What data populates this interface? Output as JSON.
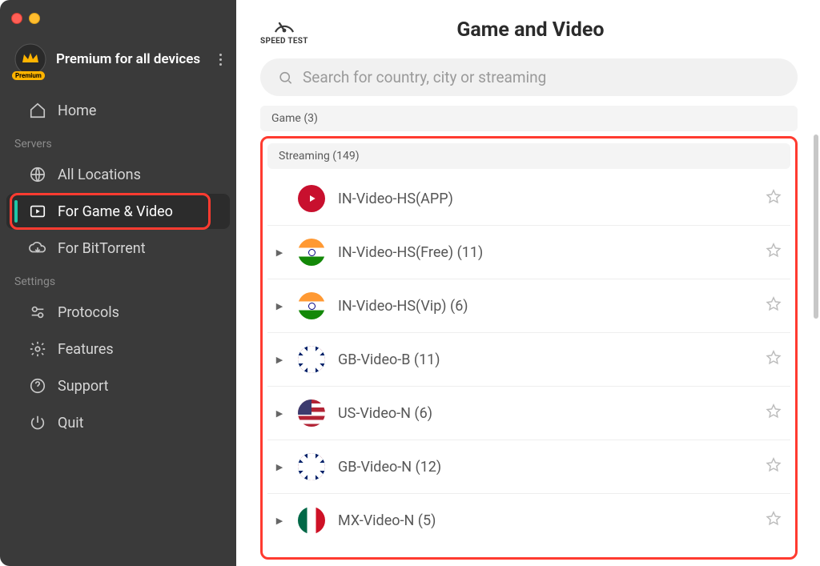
{
  "sidebar": {
    "premium_title": "Premium for all devices",
    "premium_pill": "Premium",
    "nav": {
      "home": "Home",
      "all_locations": "All Locations",
      "game_video": "For Game & Video",
      "bittorrent": "For BitTorrent",
      "protocols": "Protocols",
      "features": "Features",
      "support": "Support",
      "quit": "Quit"
    },
    "sections": {
      "servers": "Servers",
      "settings": "Settings"
    }
  },
  "main": {
    "speed_test": "SPEED TEST",
    "title": "Game and Video",
    "search_placeholder": "Search for country, city or streaming",
    "groups": {
      "game": "Game (3)",
      "streaming": "Streaming (149)"
    },
    "servers": [
      {
        "name": "IN-Video-HS(APP)",
        "flag": "hotstar",
        "expandable": false
      },
      {
        "name": "IN-Video-HS(Free) (11)",
        "flag": "in",
        "expandable": true
      },
      {
        "name": "IN-Video-HS(Vip) (6)",
        "flag": "in",
        "expandable": true
      },
      {
        "name": "GB-Video-B (11)",
        "flag": "gb",
        "expandable": true
      },
      {
        "name": "US-Video-N (6)",
        "flag": "us",
        "expandable": true
      },
      {
        "name": "GB-Video-N (12)",
        "flag": "gb",
        "expandable": true
      },
      {
        "name": "MX-Video-N (5)",
        "flag": "mx",
        "expandable": true
      }
    ]
  }
}
